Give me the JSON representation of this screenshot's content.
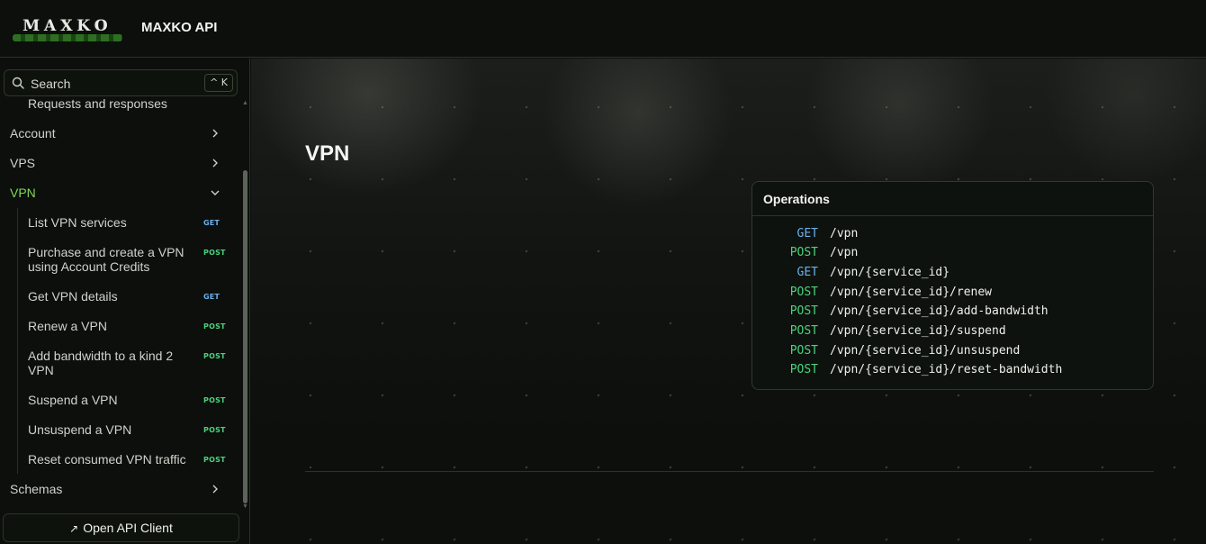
{
  "header": {
    "logo_text": "MAXKO",
    "title": "MAXKO API"
  },
  "sidebar": {
    "search": {
      "placeholder": "Search",
      "shortcut": "^ K",
      "icon": "search-icon"
    },
    "items": [
      {
        "label": "Requests and responses"
      },
      {
        "label": "Account",
        "icon": "chevron-right-icon"
      },
      {
        "label": "VPS",
        "icon": "chevron-right-icon"
      },
      {
        "label": "VPN",
        "icon": "chevron-down-icon",
        "active": true
      },
      {
        "label": "Schemas",
        "icon": "chevron-right-icon"
      }
    ],
    "vpn_items": [
      {
        "label": "List VPN services",
        "method": "GET"
      },
      {
        "label": "Purchase and create a VPN using Account Credits",
        "method": "POST"
      },
      {
        "label": "Get VPN details",
        "method": "GET"
      },
      {
        "label": "Renew a VPN",
        "method": "POST"
      },
      {
        "label": "Add bandwidth to a kind 2 VPN",
        "method": "POST"
      },
      {
        "label": "Suspend a VPN",
        "method": "POST"
      },
      {
        "label": "Unsuspend a VPN",
        "method": "POST"
      },
      {
        "label": "Reset consumed VPN traffic",
        "method": "POST"
      }
    ],
    "open_client": {
      "label": "Open API Client",
      "icon": "arrow-up-right-icon"
    }
  },
  "main": {
    "title": "VPN",
    "operations": {
      "title": "Operations",
      "rows": [
        {
          "method": "GET",
          "path": "/vpn"
        },
        {
          "method": "POST",
          "path": "/vpn"
        },
        {
          "method": "GET",
          "path": "/vpn/{service_id}"
        },
        {
          "method": "POST",
          "path": "/vpn/{service_id}/renew"
        },
        {
          "method": "POST",
          "path": "/vpn/{service_id}/add-bandwidth"
        },
        {
          "method": "POST",
          "path": "/vpn/{service_id}/suspend"
        },
        {
          "method": "POST",
          "path": "/vpn/{service_id}/unsuspend"
        },
        {
          "method": "POST",
          "path": "/vpn/{service_id}/reset-bandwidth"
        }
      ]
    }
  },
  "colors": {
    "accent": "#7ed957",
    "get": "#6ab0ea",
    "post": "#4bd27b",
    "background": "#0c0f0c"
  }
}
